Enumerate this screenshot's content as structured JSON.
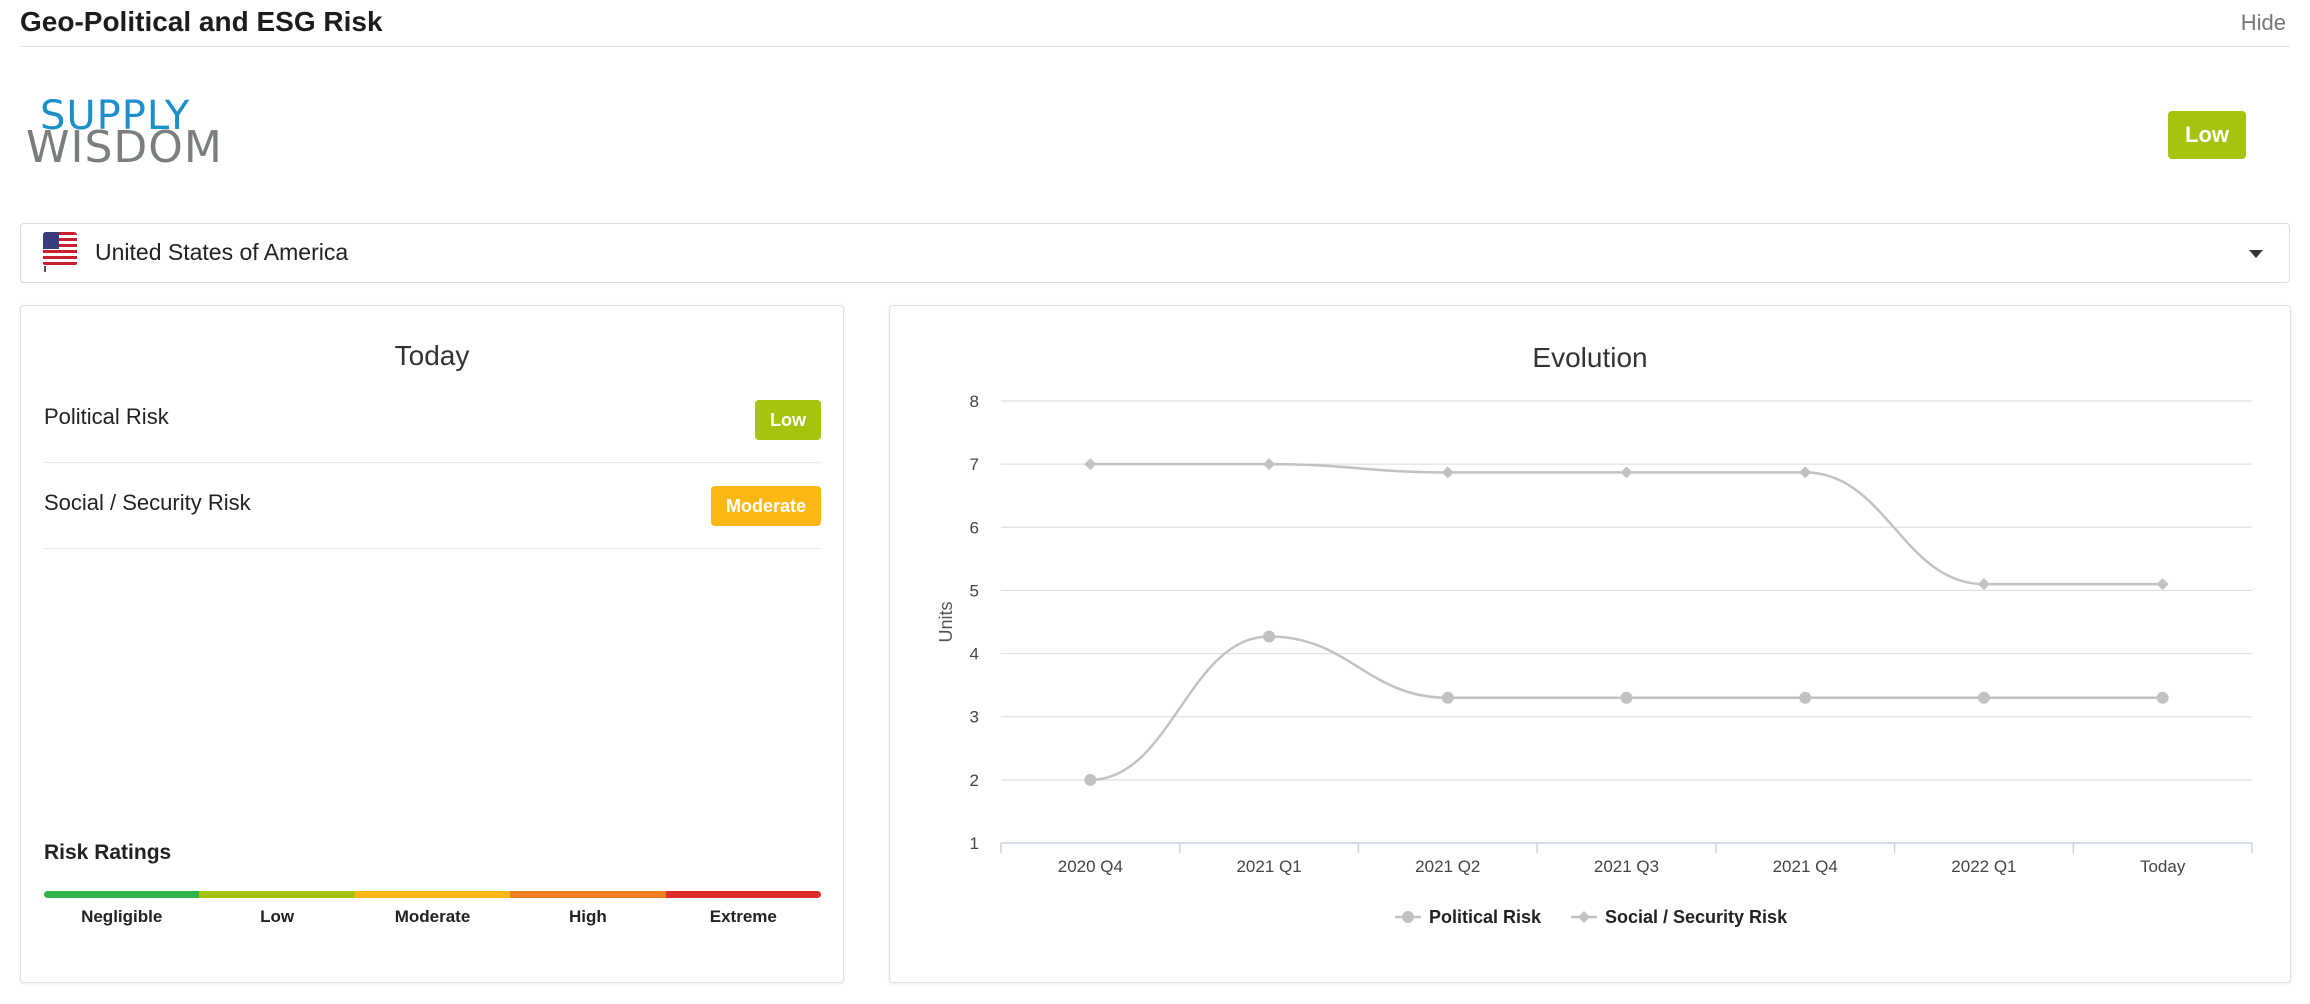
{
  "header": {
    "title": "Geo-Political and ESG Risk",
    "hide_label": "Hide"
  },
  "logo": {
    "line1": "SUPPLY",
    "line2": "WISDOM"
  },
  "overall": {
    "label": "Low",
    "color": "#a8c30d"
  },
  "country": {
    "selected": "United States of America",
    "flag_icon": "us-flag-icon"
  },
  "today": {
    "title": "Today",
    "risks": [
      {
        "label": "Political Risk",
        "rating": "Low",
        "color": "#a8c30d"
      },
      {
        "label": "Social / Security Risk",
        "rating": "Moderate",
        "color": "#fbb713"
      }
    ],
    "ratings_title": "Risk Ratings",
    "ratings": [
      {
        "label": "Negligible",
        "color": "#2db34a"
      },
      {
        "label": "Low",
        "color": "#a8c30d"
      },
      {
        "label": "Moderate",
        "color": "#fbb713"
      },
      {
        "label": "High",
        "color": "#f07f22"
      },
      {
        "label": "Extreme",
        "color": "#dd2e2e"
      }
    ]
  },
  "evolution": {
    "title": "Evolution"
  },
  "chart_data": {
    "type": "line",
    "title": "Evolution",
    "xlabel": "",
    "ylabel": "Units",
    "categories": [
      "2020 Q4",
      "2021 Q1",
      "2021 Q2",
      "2021 Q3",
      "2021 Q4",
      "2022 Q1",
      "Today"
    ],
    "ylim": [
      1,
      8
    ],
    "yticks": [
      1,
      2,
      3,
      4,
      5,
      6,
      7,
      8
    ],
    "grid": true,
    "legend": "bottom-center",
    "series": [
      {
        "name": "Political Risk",
        "marker": "circle",
        "color": "#c2c2c2",
        "values": [
          2.0,
          4.27,
          3.3,
          3.3,
          3.3,
          3.3,
          3.3
        ]
      },
      {
        "name": "Social / Security Risk",
        "marker": "diamond",
        "color": "#c2c2c2",
        "values": [
          7.0,
          7.0,
          6.87,
          6.87,
          6.87,
          5.1,
          5.1
        ]
      }
    ]
  }
}
